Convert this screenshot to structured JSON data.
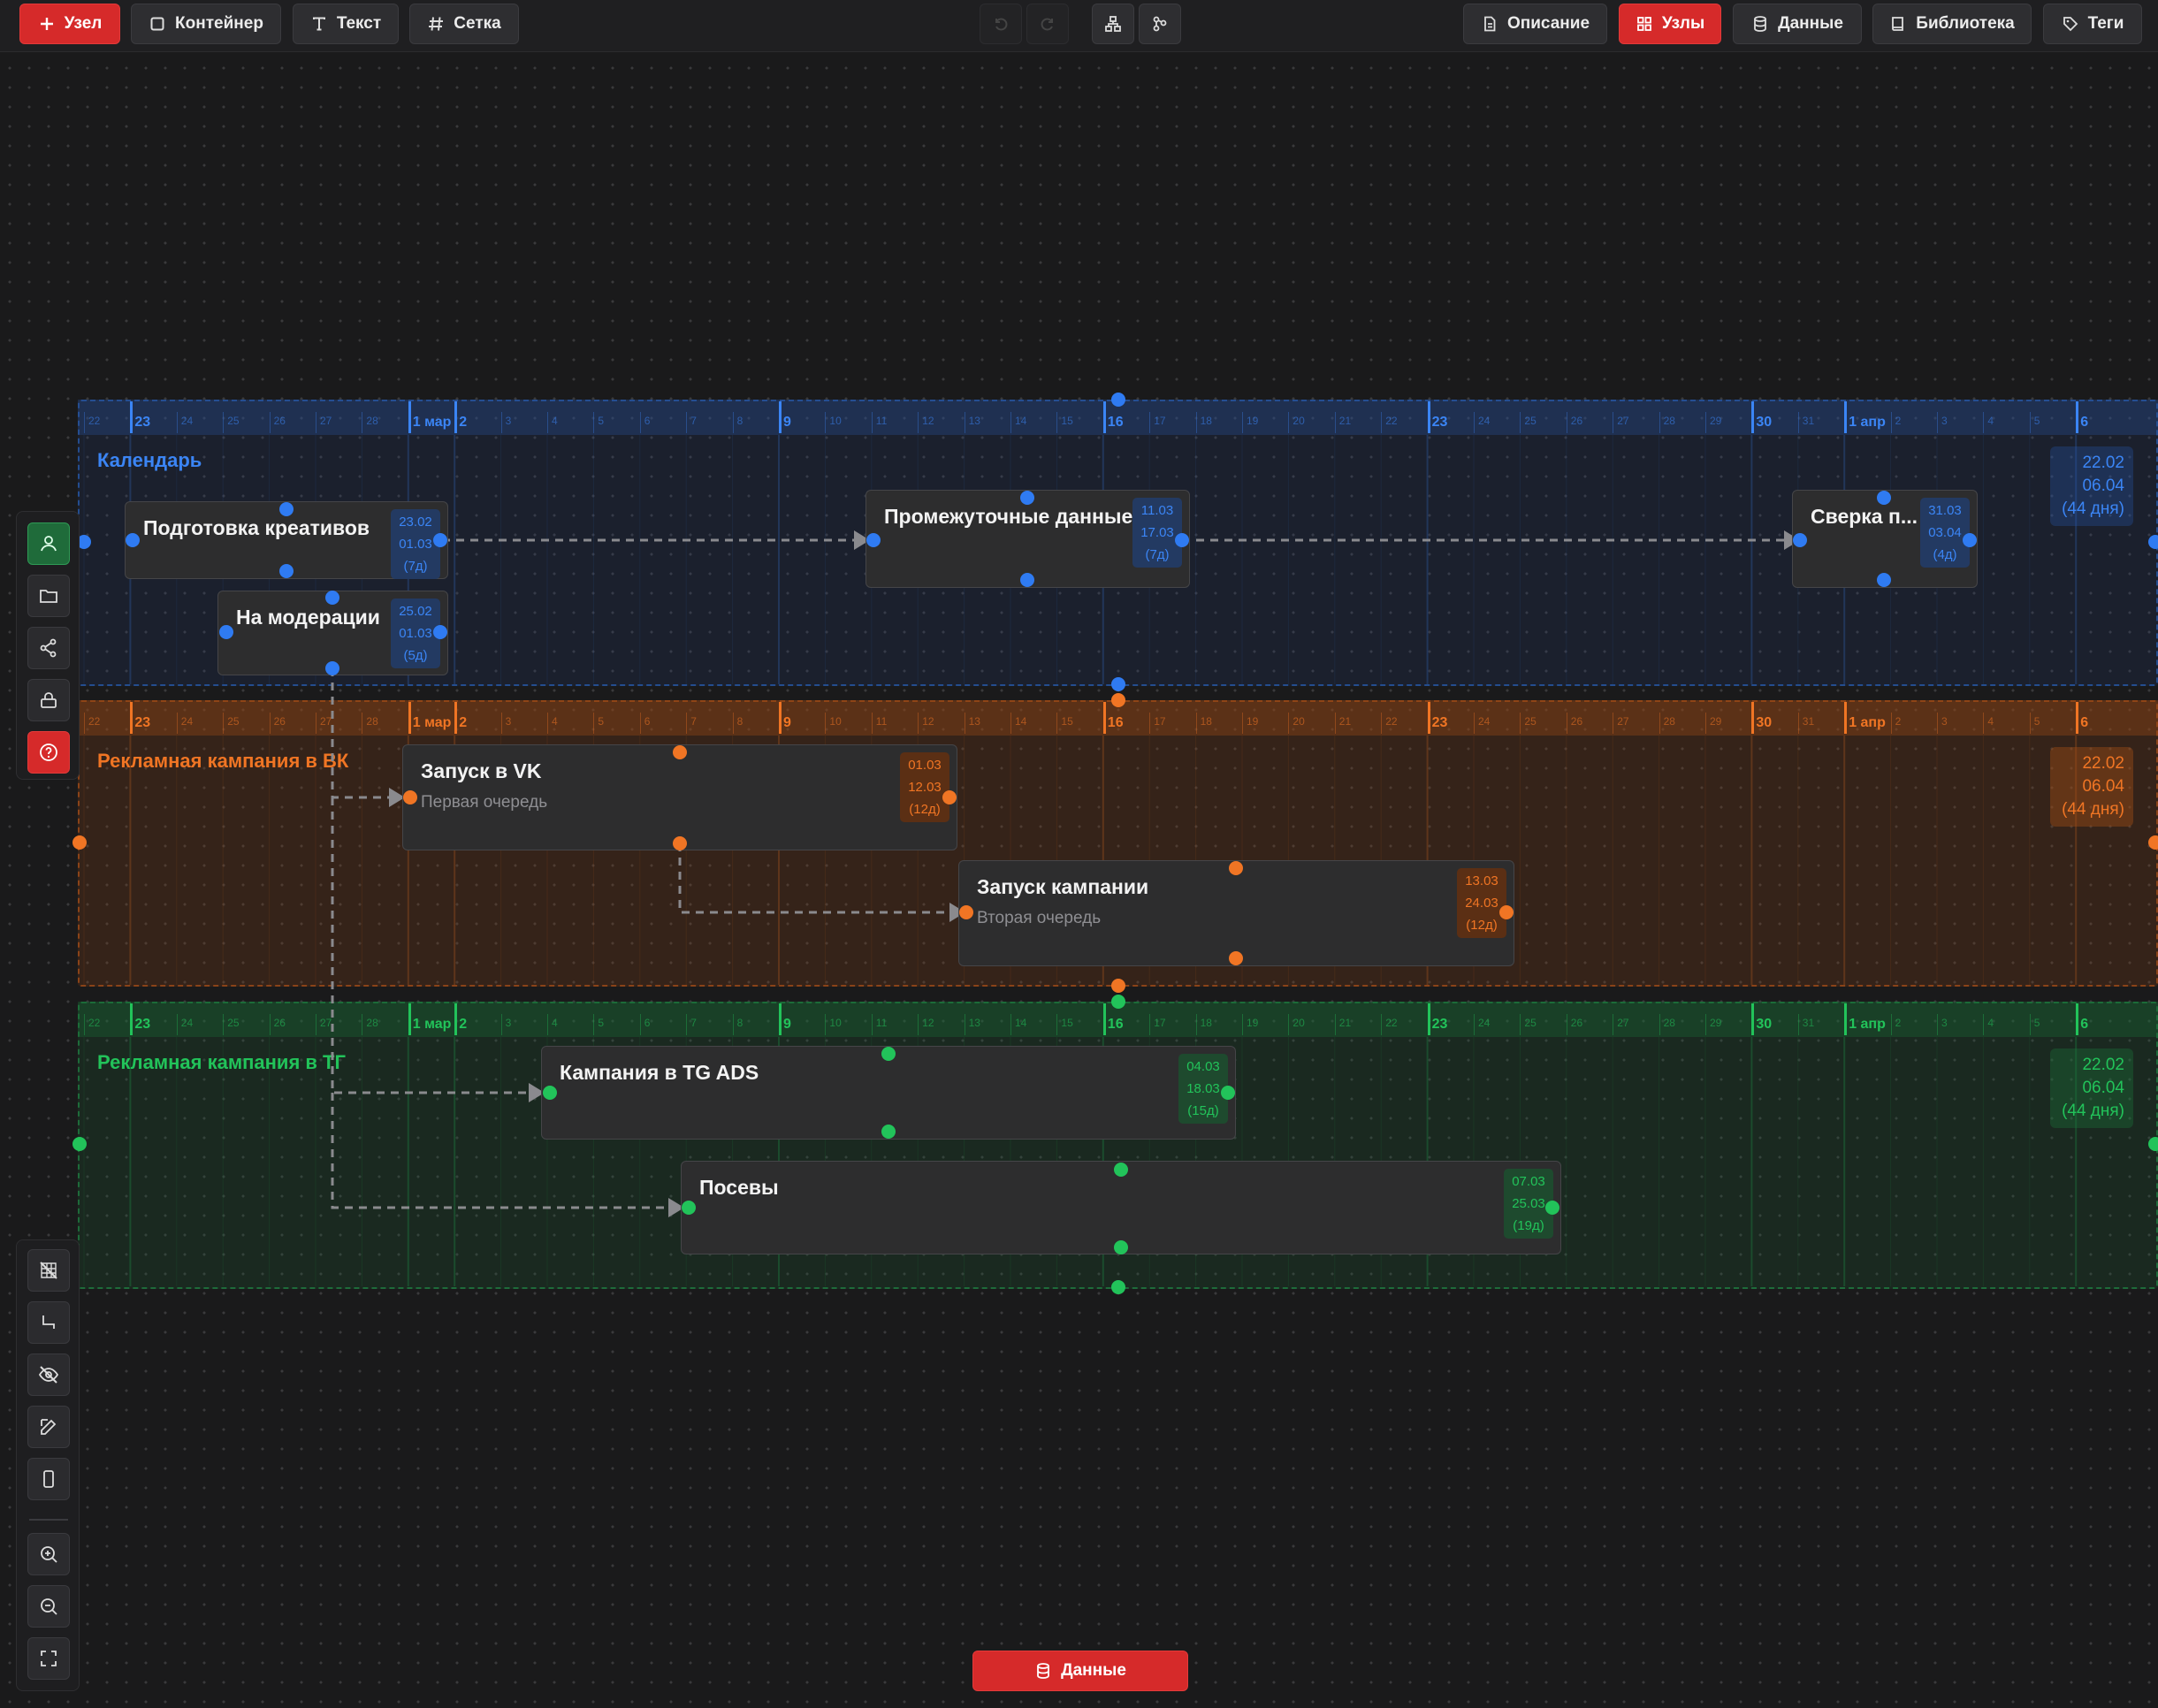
{
  "toolbar": {
    "add_node": "Узел",
    "container": "Контейнер",
    "text": "Текст",
    "grid": "Сетка",
    "description": "Описание",
    "nodes": "Узлы",
    "data": "Данные",
    "library": "Библиотека",
    "tags": "Теги"
  },
  "left_toolbar": {
    "icons": [
      "user-icon",
      "folder-icon",
      "share-icon",
      "lock-icon",
      "help-icon"
    ]
  },
  "bottom_toolbar": {
    "icons": [
      "grid-off-icon",
      "connector-icon",
      "eye-off-icon",
      "edit-icon",
      "device-icon",
      "zoom-in-icon",
      "zoom-out-icon",
      "fullscreen-icon"
    ]
  },
  "timeline_ticks": [
    {
      "label": "22",
      "major": false
    },
    {
      "label": "23",
      "major": true
    },
    {
      "label": "24",
      "major": false
    },
    {
      "label": "25",
      "major": false
    },
    {
      "label": "26",
      "major": false
    },
    {
      "label": "27",
      "major": false
    },
    {
      "label": "28",
      "major": false
    },
    {
      "label": "1 мар",
      "major": true
    },
    {
      "label": "2",
      "major": true
    },
    {
      "label": "3",
      "major": false
    },
    {
      "label": "4",
      "major": false
    },
    {
      "label": "5",
      "major": false
    },
    {
      "label": "6",
      "major": false
    },
    {
      "label": "7",
      "major": false
    },
    {
      "label": "8",
      "major": false
    },
    {
      "label": "9",
      "major": true
    },
    {
      "label": "10",
      "major": false
    },
    {
      "label": "11",
      "major": false
    },
    {
      "label": "12",
      "major": false
    },
    {
      "label": "13",
      "major": false
    },
    {
      "label": "14",
      "major": false
    },
    {
      "label": "15",
      "major": false
    },
    {
      "label": "16",
      "major": true
    },
    {
      "label": "17",
      "major": false
    },
    {
      "label": "18",
      "major": false
    },
    {
      "label": "19",
      "major": false
    },
    {
      "label": "20",
      "major": false
    },
    {
      "label": "21",
      "major": false
    },
    {
      "label": "22",
      "major": false
    },
    {
      "label": "23",
      "major": true
    },
    {
      "label": "24",
      "major": false
    },
    {
      "label": "25",
      "major": false
    },
    {
      "label": "26",
      "major": false
    },
    {
      "label": "27",
      "major": false
    },
    {
      "label": "28",
      "major": false
    },
    {
      "label": "29",
      "major": false
    },
    {
      "label": "30",
      "major": true
    },
    {
      "label": "31",
      "major": false
    },
    {
      "label": "1 апр",
      "major": true
    },
    {
      "label": "2",
      "major": false
    },
    {
      "label": "3",
      "major": false
    },
    {
      "label": "4",
      "major": false
    },
    {
      "label": "5",
      "major": false
    },
    {
      "label": "6",
      "major": true
    }
  ],
  "containers": [
    {
      "title": "Календарь",
      "start": "22.02",
      "end": "06.04",
      "duration": "(44 дня)",
      "color": "#2f7bf2"
    },
    {
      "title": "Рекламная кампания в ВК",
      "start": "22.02",
      "end": "06.04",
      "duration": "(44 дня)",
      "color": "#f07524"
    },
    {
      "title": "Рекламная кампания в ТГ",
      "start": "22.02",
      "end": "06.04",
      "duration": "(44 дня)",
      "color": "#22c35a"
    }
  ],
  "nodes": [
    {
      "title": "Подготовка креативов",
      "subtitle": "",
      "start": "23.02",
      "end": "01.03",
      "duration": "(7д)"
    },
    {
      "title": "На модерации",
      "subtitle": "",
      "start": "25.02",
      "end": "01.03",
      "duration": "(5д)"
    },
    {
      "title": "Промежуточные данные",
      "subtitle": "",
      "start": "11.03",
      "end": "17.03",
      "duration": "(7д)"
    },
    {
      "title": "Сверка п...",
      "subtitle": "",
      "start": "31.03",
      "end": "03.04",
      "duration": "(4д)"
    },
    {
      "title": "Запуск в VK",
      "subtitle": "Первая очередь",
      "start": "01.03",
      "end": "12.03",
      "duration": "(12д)"
    },
    {
      "title": "Запуск кампании",
      "subtitle": "Вторая очередь",
      "start": "13.03",
      "end": "24.03",
      "duration": "(12д)"
    },
    {
      "title": "Кампания в TG ADS",
      "subtitle": "",
      "start": "04.03",
      "end": "18.03",
      "duration": "(15д)"
    },
    {
      "title": "Посевы",
      "subtitle": "",
      "start": "07.03",
      "end": "25.03",
      "duration": "(19д)"
    }
  ],
  "bottom_button": "Данные"
}
